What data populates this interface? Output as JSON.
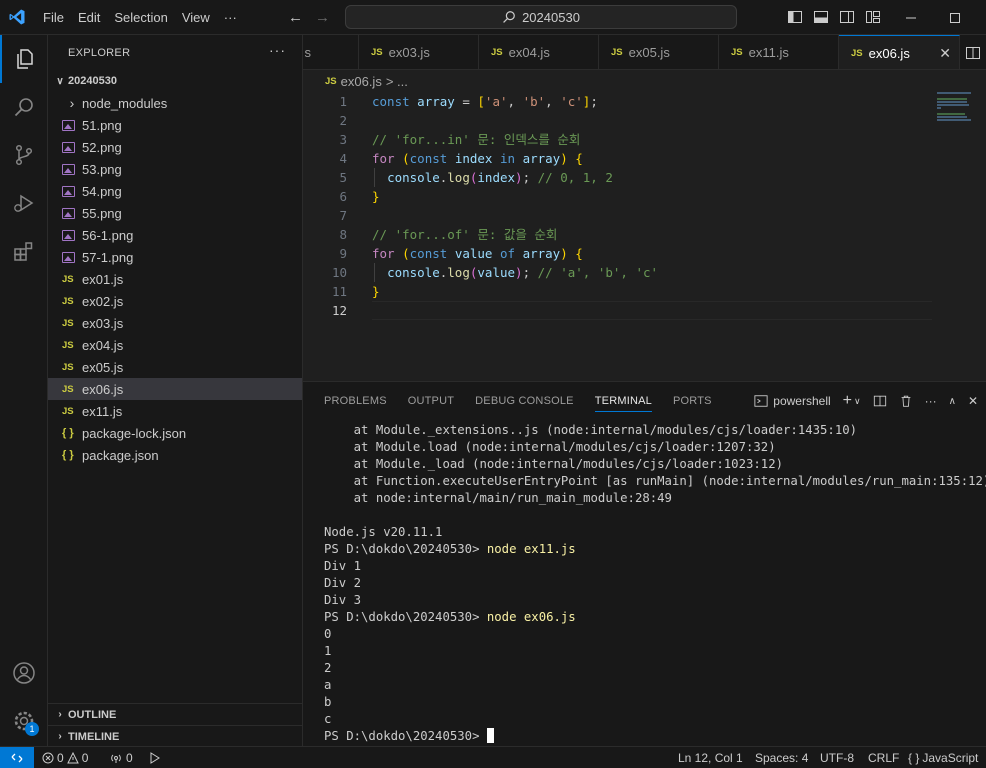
{
  "titlebar": {
    "menu": [
      "File",
      "Edit",
      "Selection",
      "View",
      "···"
    ],
    "search": "20240530"
  },
  "sidebar": {
    "title": "EXPLORER",
    "root": "20240530",
    "items": [
      {
        "label": "node_modules",
        "type": "folder"
      },
      {
        "label": "51.png",
        "type": "image"
      },
      {
        "label": "52.png",
        "type": "image"
      },
      {
        "label": "53.png",
        "type": "image"
      },
      {
        "label": "54.png",
        "type": "image"
      },
      {
        "label": "55.png",
        "type": "image"
      },
      {
        "label": "56-1.png",
        "type": "image"
      },
      {
        "label": "57-1.png",
        "type": "image"
      },
      {
        "label": "ex01.js",
        "type": "js"
      },
      {
        "label": "ex02.js",
        "type": "js"
      },
      {
        "label": "ex03.js",
        "type": "js"
      },
      {
        "label": "ex04.js",
        "type": "js"
      },
      {
        "label": "ex05.js",
        "type": "js"
      },
      {
        "label": "ex06.js",
        "type": "js",
        "selected": true
      },
      {
        "label": "ex11.js",
        "type": "js"
      },
      {
        "label": "package-lock.json",
        "type": "json"
      },
      {
        "label": "package.json",
        "type": "json"
      }
    ],
    "outline": "OUTLINE",
    "timeline": "TIMELINE",
    "accounts_badge": "1"
  },
  "tabs": [
    {
      "label": "s",
      "partial": true
    },
    {
      "label": "ex03.js"
    },
    {
      "label": "ex04.js"
    },
    {
      "label": "ex05.js"
    },
    {
      "label": "ex11.js"
    },
    {
      "label": "ex06.js",
      "active": true
    }
  ],
  "editor": {
    "breadcrumb_file": "ex06.js",
    "breadcrumb_rest": "> ...",
    "line_numbers": [
      "1",
      "2",
      "3",
      "4",
      "5",
      "6",
      "7",
      "8",
      "9",
      "10",
      "11",
      "12"
    ],
    "current_line": "12"
  },
  "panel": {
    "tabs": [
      "PROBLEMS",
      "OUTPUT",
      "DEBUG CONSOLE",
      "TERMINAL",
      "PORTS"
    ],
    "active_tab": "TERMINAL",
    "shell": "powershell",
    "terminal": {
      "trace": [
        "    at Module._extensions..js (node:internal/modules/cjs/loader:1435:10)",
        "    at Module.load (node:internal/modules/cjs/loader:1207:32)",
        "    at Module._load (node:internal/modules/cjs/loader:1023:12)",
        "    at Function.executeUserEntryPoint [as runMain] (node:internal/modules/run_main:135:12)",
        "    at node:internal/main/run_main_module:28:49"
      ],
      "node_version": "Node.js v20.11.1",
      "prompt": "PS D:\\dokdo\\20240530> ",
      "cmd1": "node ex11.js",
      "out1": [
        "Div 1",
        "Div 2",
        "Div 3"
      ],
      "cmd2": "node ex06.js",
      "out2": [
        "0",
        "1",
        "2",
        "a",
        "b",
        "c"
      ]
    }
  },
  "statusbar": {
    "errors": "0",
    "warnings": "0",
    "ports": "0",
    "position": "Ln 12, Col 1",
    "spaces": "Spaces: 4",
    "encoding": "UTF-8",
    "eol": "CRLF",
    "language": "JavaScript",
    "language_icon": "{ }"
  },
  "colors": {
    "accent": "#0078d4",
    "js_icon": "#cbcb41",
    "image_icon": "#a074c4"
  }
}
